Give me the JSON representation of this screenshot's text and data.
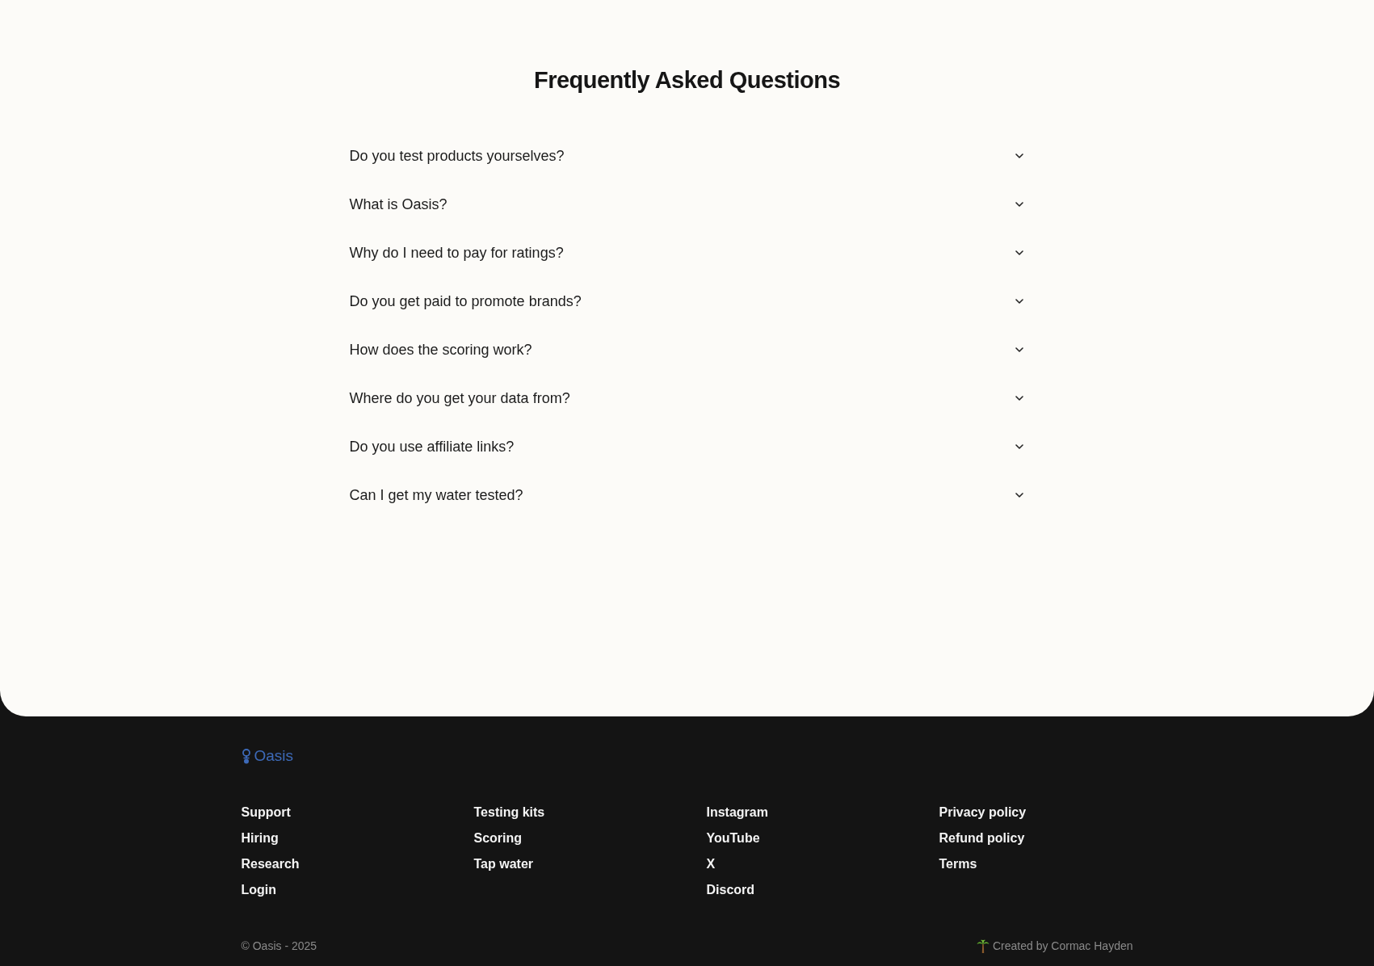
{
  "faq": {
    "title": "Frequently Asked Questions",
    "items": [
      {
        "question": "Do you test products yourselves?",
        "expanded": false
      },
      {
        "question": "What is Oasis?",
        "expanded": false
      },
      {
        "question": "Why do I need to pay for ratings?",
        "expanded": false
      },
      {
        "question": "Do you get paid to promote brands?",
        "expanded": false
      },
      {
        "question": "How does the scoring work?",
        "expanded": false
      },
      {
        "question": "Where do you get your data from?",
        "expanded": false
      },
      {
        "question": "Do you use affiliate links?",
        "expanded": false
      },
      {
        "question": "Can I get my water tested?",
        "expanded": false
      }
    ]
  },
  "footer": {
    "logo": {
      "text": "Oasis"
    },
    "columns": [
      {
        "links": [
          "Support",
          "Hiring",
          "Research",
          "Login"
        ]
      },
      {
        "links": [
          "Testing kits",
          "Scoring",
          "Tap water"
        ]
      },
      {
        "links": [
          "Instagram",
          "YouTube",
          "X",
          "Discord"
        ]
      },
      {
        "links": [
          "Privacy policy",
          "Refund policy",
          "Terms"
        ]
      }
    ],
    "copyright": "© Oasis - 2025",
    "credit": "Created by Cormac Hayden"
  }
}
